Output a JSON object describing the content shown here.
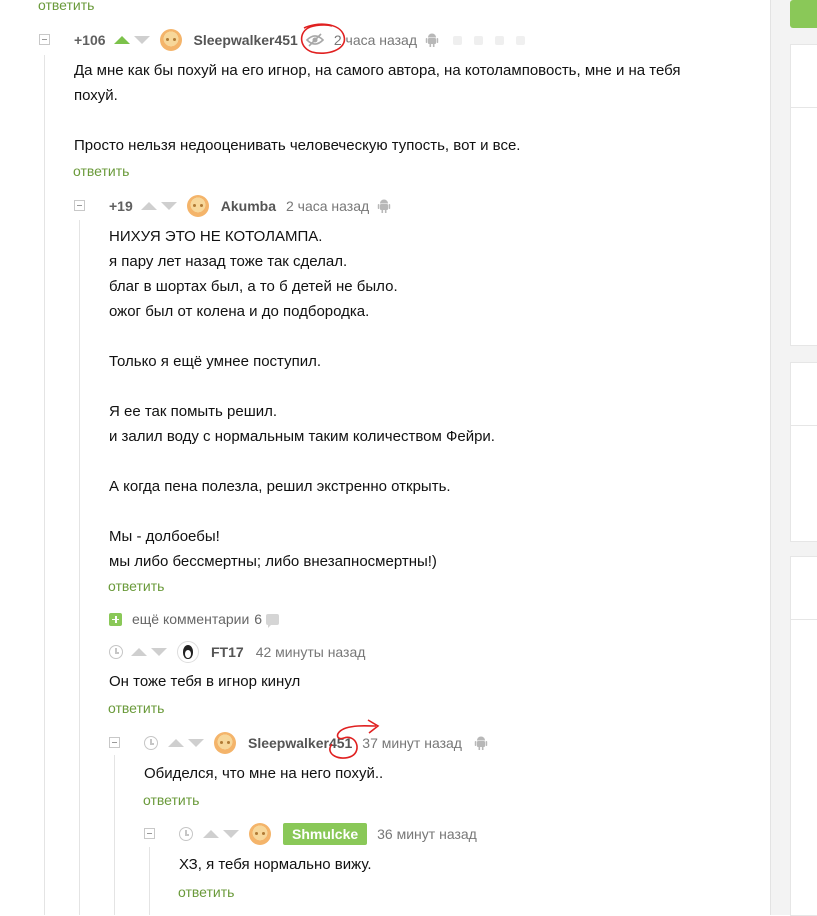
{
  "reply_label": "ответить",
  "comments": [
    {
      "id": "c1",
      "rating": "+106",
      "user": "Sleepwalker451",
      "time": "2 часа назад",
      "body": "Да мне как бы похуй на его игнор, на самого автора, на котоламповость, мне и на тебя\nпохуй.\n\nПросто нельзя недооценивать человеческую тупость, вот и все."
    },
    {
      "id": "c2",
      "rating": "+19",
      "user": "Akumba",
      "time": "2 часа назад",
      "body": "НИХУЯ ЭТО НЕ КОТОЛАМПА.\nя пару лет назад тоже так сделал.\nблаг в шортах был, а то б детей не было.\nожог был от колена и до подбородка.\n\nТолько я ещё умнее поступил.\n\nЯ ее так помыть решил.\nи залил воду с нормальным таким количеством Фейри.\n\nА когда пена полезла, решил экстренно открыть.\n\nМы - долбоебы!\nмы либо бессмертны; либо внезапносмертны!)"
    },
    {
      "id": "c3",
      "user": "FT17",
      "time": "42 минуты назад",
      "body": "Он тоже тебя в игнор кинул"
    },
    {
      "id": "c4",
      "user": "Sleepwalker451",
      "time": "37 минут назад",
      "body": "Обиделся, что мне на него похуй.."
    },
    {
      "id": "c5",
      "user": "Shmulcke",
      "time": "36 минут назад",
      "body": "ХЗ, я тебя нормально вижу."
    }
  ],
  "more_comments": {
    "label": "ещё комментарии",
    "count": "6"
  },
  "icons": {
    "vote_up": "triangle-up-icon",
    "vote_down": "triangle-down-icon",
    "hidden": "eye-crossed-icon",
    "device": "android-icon",
    "clock": "clock-icon",
    "expand": "plus-icon",
    "comments": "speech-bubble-icon"
  },
  "colors": {
    "accent_green": "#8ac858",
    "link_green": "#6a9a3a",
    "annotation_red": "#e02020"
  }
}
